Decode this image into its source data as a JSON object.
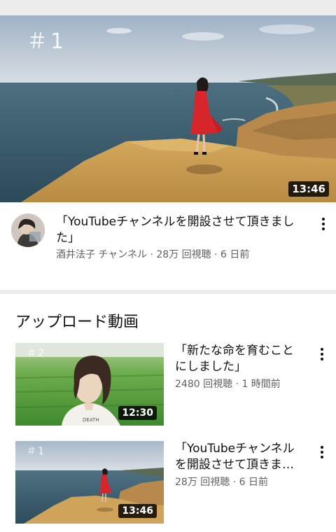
{
  "featured": {
    "overlay_number": "＃1",
    "duration": "13:46",
    "title": "「YouTubeチャンネルを開設させて頂きました」",
    "channel": "酒井法子 チャンネル",
    "meta_sep1": " · ",
    "views": "28万 回視聴",
    "meta_sep2": " · ",
    "age": "6 日前",
    "menu_icon": "more-vert-icon"
  },
  "uploads": {
    "heading": "アップロード動画",
    "items": [
      {
        "overlay_number": "＃2",
        "duration": "12:30",
        "title": "「新たな命を育むことにしました」",
        "views": "2480 回視聴",
        "sep": " · ",
        "age": "1 時間前"
      },
      {
        "overlay_number": "＃1",
        "duration": "13:46",
        "title": "「YouTubeチャンネルを開設させて頂きました」",
        "views": "28万 回視聴",
        "sep": " · ",
        "age": "6 日前"
      }
    ]
  },
  "colors": {
    "background": "#ffffff",
    "separator": "#ececec",
    "meta_text": "#606060",
    "dress_red": "#d6262b",
    "cliff_sand": "#c99a4c"
  }
}
